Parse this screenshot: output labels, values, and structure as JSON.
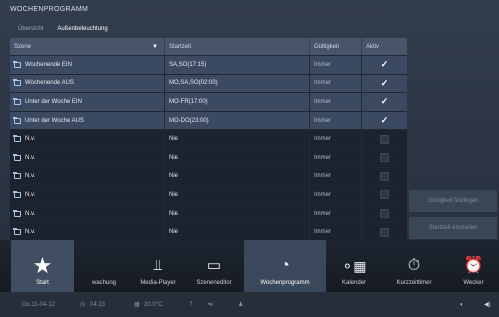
{
  "header": {
    "title": "WOCHENPROGRAMM"
  },
  "tabs": [
    {
      "label": "Übersicht",
      "active": false
    },
    {
      "label": "Außenbeleuchtung",
      "active": true
    }
  ],
  "table": {
    "columns": {
      "scene": "Szene",
      "start": "Startzeit",
      "validity": "Gültigkeit",
      "active": "Aktiv"
    },
    "rows": [
      {
        "scene": "Wochenende EIN",
        "start": "SA,SO(17:15)",
        "validity": "Immer",
        "active": true
      },
      {
        "scene": "Wochenende AUS",
        "start": "MO,SA,SO(02:00)",
        "validity": "Immer",
        "active": true
      },
      {
        "scene": "Unter der Woche EIN",
        "start": "MO-FR(17:00)",
        "validity": "Immer",
        "active": true
      },
      {
        "scene": "Unter der Woche AUS",
        "start": "MO-DO(23:00)",
        "validity": "Immer",
        "active": true
      },
      {
        "scene": "N.v.",
        "start": "Nie",
        "validity": "Immer",
        "active": false
      },
      {
        "scene": "N.v.",
        "start": "Nie",
        "validity": "Immer",
        "active": false
      },
      {
        "scene": "N.v.",
        "start": "Nie",
        "validity": "Immer",
        "active": false
      },
      {
        "scene": "N.v.",
        "start": "Nie",
        "validity": "Immer",
        "active": false
      },
      {
        "scene": "N.v.",
        "start": "Nie",
        "validity": "Immer",
        "active": false
      },
      {
        "scene": "N.v.",
        "start": "Nie",
        "validity": "Immer",
        "active": false
      }
    ]
  },
  "side_buttons": {
    "validity": "Gültigkeit festlegen",
    "start_time": "Startzeit einstellen"
  },
  "dock": [
    {
      "label": "Start",
      "icon": "star-icon"
    },
    {
      "label": "wachung",
      "icon": "monitoring-icon"
    },
    {
      "label": "Media-Player",
      "icon": "media-player-icon"
    },
    {
      "label": "Szeneneditor",
      "icon": "clapperboard-icon"
    },
    {
      "label": "Wochenprogramm",
      "icon": "weekly-program-icon"
    },
    {
      "label": "Kalender",
      "icon": "calendar-icon"
    },
    {
      "label": "Kurzzeittimer",
      "icon": "timer-icon"
    },
    {
      "label": "Wecker",
      "icon": "alarm-clock-icon"
    }
  ],
  "status": {
    "date": "Do.11-04-12",
    "time": "04:23",
    "temperature": "20.0°C"
  }
}
